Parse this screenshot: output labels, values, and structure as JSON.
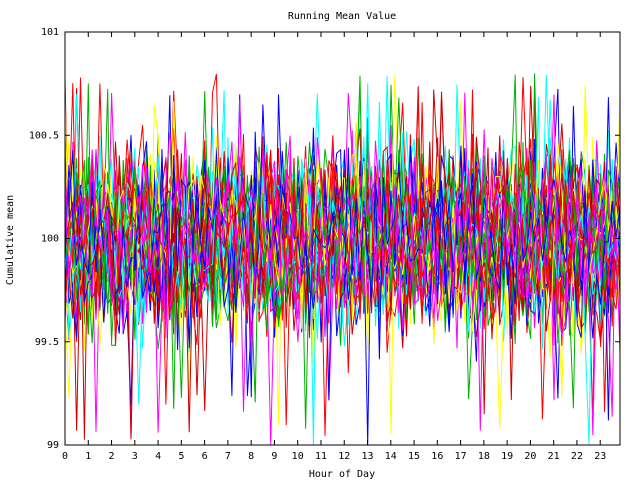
{
  "chart_data": {
    "type": "line",
    "title": "Running Mean Value",
    "xlabel": "Hour of Day",
    "ylabel": "Cumulative mean",
    "xlim": [
      0,
      23.85
    ],
    "ylim": [
      99,
      101
    ],
    "x_ticks": [
      "0",
      "1",
      "2",
      "3",
      "4",
      "5",
      "6",
      "7",
      "8",
      "9",
      "10",
      "11",
      "12",
      "13",
      "14",
      "15",
      "16",
      "17",
      "18",
      "19",
      "20",
      "21",
      "22",
      "23"
    ],
    "y_ticks": [
      "99",
      "99.5",
      "100",
      "100.5",
      "101"
    ],
    "grid": false,
    "legend": "none",
    "series_colors": [
      "#ff0000",
      "#00b000",
      "#0000ff",
      "#ff00ff",
      "#00ffff",
      "#ffff00",
      "#cc0000"
    ],
    "series_count_estimate": 60,
    "points_per_hour": 6,
    "central_value": 100,
    "typical_range": [
      99.55,
      100.45
    ],
    "extreme_range": [
      99,
      100.8
    ],
    "noise_seed": 7
  }
}
